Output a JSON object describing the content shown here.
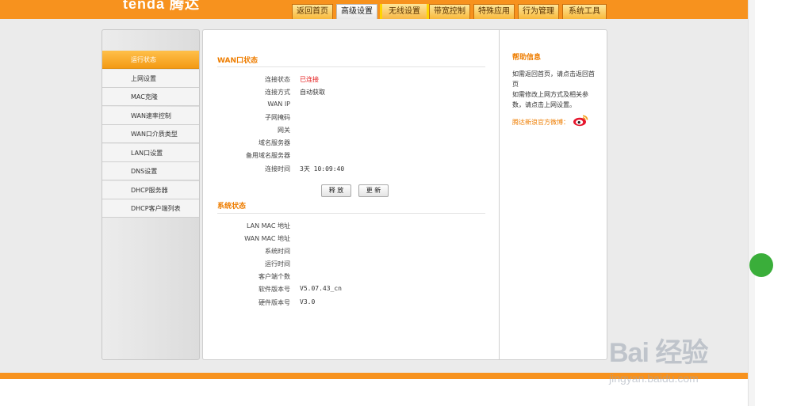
{
  "header": {
    "logo_text": "tenda 腾达",
    "tabs": [
      {
        "label": "返回首页"
      },
      {
        "label": "高级设置"
      },
      {
        "label": "无线设置"
      },
      {
        "label": "带宽控制"
      },
      {
        "label": "特殊应用"
      },
      {
        "label": "行为管理"
      },
      {
        "label": "系统工具"
      }
    ]
  },
  "sidebar": {
    "items": [
      {
        "label": "运行状态"
      },
      {
        "label": "上网设置"
      },
      {
        "label": "MAC克隆"
      },
      {
        "label": "WAN速率控制"
      },
      {
        "label": "WAN口介质类型"
      },
      {
        "label": "LAN口设置"
      },
      {
        "label": "DNS设置"
      },
      {
        "label": "DHCP服务器"
      },
      {
        "label": "DHCP客户端列表"
      }
    ]
  },
  "wan": {
    "title": "WAN口状态",
    "rows": [
      {
        "label": "连接状态",
        "value": "已连接"
      },
      {
        "label": "连接方式",
        "value": "自动获取"
      },
      {
        "label": "WAN IP",
        "value": ""
      },
      {
        "label": "子网掩码",
        "value": ""
      },
      {
        "label": "网关",
        "value": ""
      },
      {
        "label": "域名服务器",
        "value": ""
      },
      {
        "label": "备用域名服务器",
        "value": ""
      },
      {
        "label": "连接时间",
        "value": "3天 10:09:40"
      }
    ],
    "release_label": "释 放",
    "renew_label": "更 新"
  },
  "system": {
    "title": "系统状态",
    "rows": [
      {
        "label": "LAN MAC 地址",
        "value": ""
      },
      {
        "label": "WAN MAC 地址",
        "value": ""
      },
      {
        "label": "系统时间",
        "value": ""
      },
      {
        "label": "运行时间",
        "value": ""
      },
      {
        "label": "客户端个数",
        "value": ""
      },
      {
        "label": "软件版本号",
        "value": "V5.07.43_cn"
      },
      {
        "label": "硬件版本号",
        "value": "V3.0"
      }
    ]
  },
  "help": {
    "title": "帮助信息",
    "text": "如需返回首页，请点击返回首页\n如需修改上网方式及相关参数，请点击上网设置。",
    "weibo": "腾达新浪官方微博：",
    "weibo_icon": "weibo-icon"
  },
  "watermark": {
    "brand": "Bai 经验",
    "url": "jingyan.baidu.com"
  },
  "colors": {
    "accent": "#f7921e",
    "title_orange": "#ee7d00",
    "status_red": "#e41b1b"
  }
}
